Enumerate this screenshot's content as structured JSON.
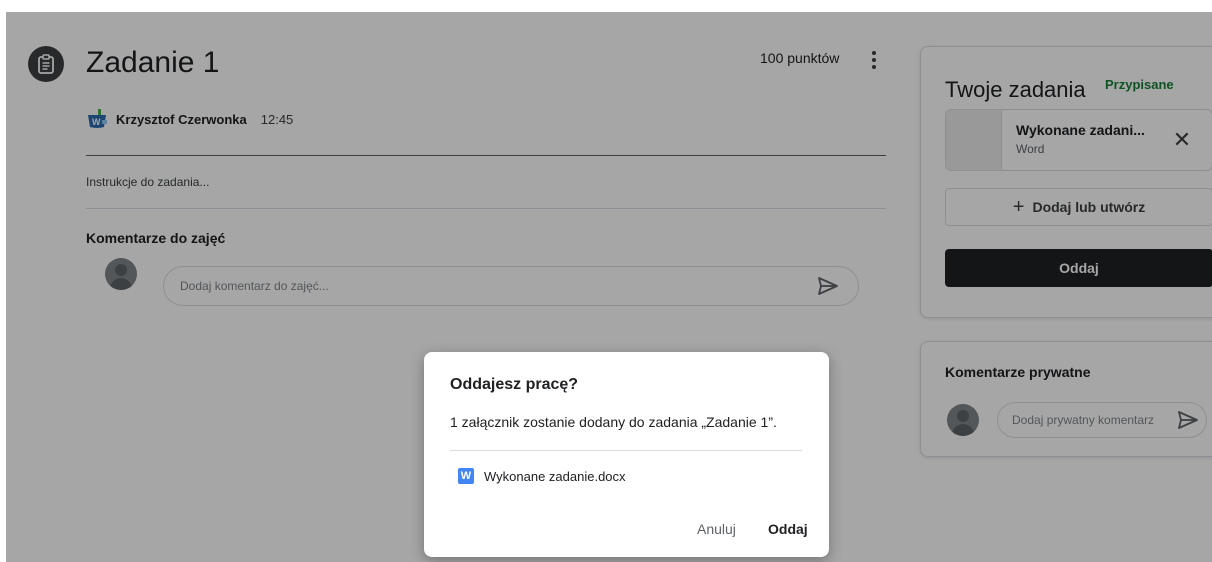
{
  "assignment": {
    "title": "Zadanie 1",
    "points": "100 punktów",
    "author": "Krzysztof Czerwonka",
    "time": "12:45",
    "instructions": "Instrukcje do zadania...",
    "class_comments_title": "Komentarze do zajęć",
    "comment_placeholder": "Dodaj komentarz do zajęć..."
  },
  "your_work": {
    "title": "Twoje zadania",
    "status": "Przypisane",
    "status_color": "#188038",
    "attachment": {
      "name": "Wykonane zadani...",
      "type": "Word"
    },
    "add_label": "Dodaj lub utwórz",
    "submit_label": "Oddaj"
  },
  "private_comments": {
    "title": "Komentarze prywatne",
    "placeholder": "Dodaj prywatny komentarz"
  },
  "dialog": {
    "title": "Oddajesz pracę?",
    "text": "1 załącznik zostanie dodany do zadania „Zadanie 1”.",
    "file_badge": "W",
    "file_name": "Wykonane zadanie.docx",
    "cancel_label": "Anuluj",
    "confirm_label": "Oddaj"
  },
  "icons": {
    "assignment": "assignment-icon",
    "more": "more-vert-icon",
    "send": "send-icon",
    "close": "close-icon",
    "add": "plus-icon",
    "word": "word-file-icon"
  }
}
